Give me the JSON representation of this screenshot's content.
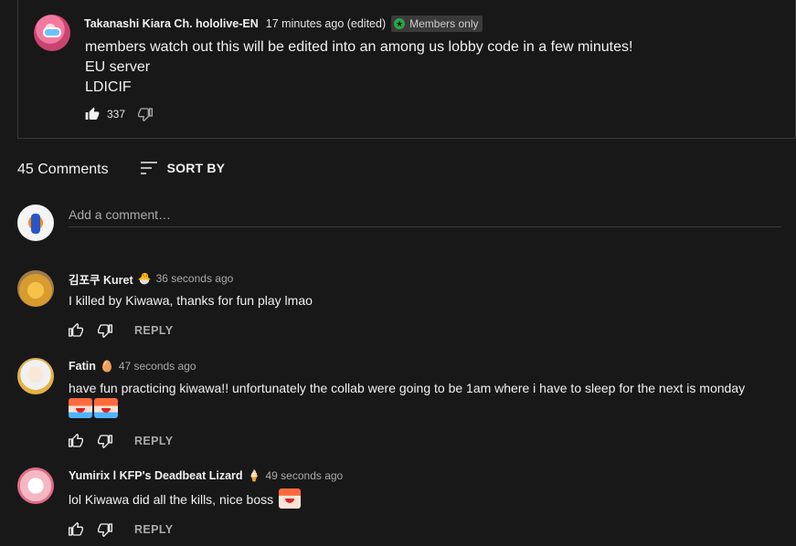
{
  "post": {
    "author": "Takanashi Kiara Ch. hololive-EN",
    "time": "17 minutes ago (edited)",
    "badge_icon": "membership-star-icon",
    "badge_label": "Members only",
    "lines": [
      "members watch out this will be edited into an among us lobby code in a few minutes!",
      "EU server",
      "LDICIF"
    ],
    "like_count": "337"
  },
  "comments_section": {
    "count_label": "45 Comments",
    "sort_label": "SORT BY",
    "add_comment_placeholder": "Add a comment…"
  },
  "comments": [
    {
      "author": "김포쿠 Kuret",
      "badge": "🐣",
      "time": "36 seconds ago",
      "text": "I killed by Kiwawa, thanks for fun play lmao",
      "reply_label": "REPLY"
    },
    {
      "author": "Fatin",
      "badge": "🥚",
      "time": "47 seconds ago",
      "text": "have fun practicing kiwawa!! unfortunately the collab were going to be 1am where i have to sleep for the next is monday",
      "emotes": [
        "crying-emote",
        "crying-emote"
      ],
      "reply_label": "REPLY"
    },
    {
      "author": "Yumirix l KFP's Deadbeat Lizard",
      "badge": "🍦",
      "time": "49 seconds ago",
      "text": "lol Kiwawa did all the kills, nice boss",
      "emotes": [
        "smile-emote"
      ],
      "reply_label": "REPLY"
    }
  ],
  "colors": {
    "background": "#181818",
    "text_primary": "#f1f1f1",
    "text_secondary": "#aaaaaa",
    "divider": "#3a3a3a",
    "member_badge_green": "#2ba640"
  }
}
